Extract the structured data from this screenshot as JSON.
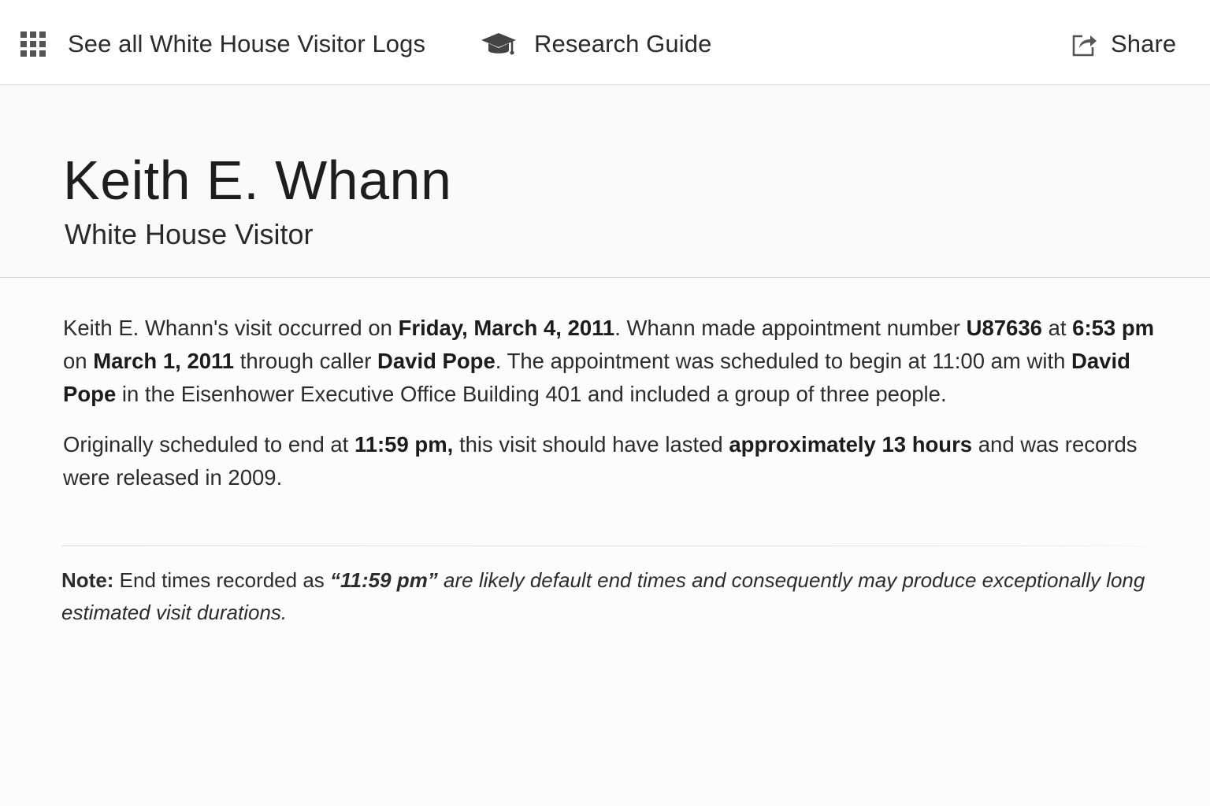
{
  "topbar": {
    "visitor_logs_label": "See all White House Visitor Logs",
    "research_label": "Research Guide",
    "share_label": "Share",
    "icons": {
      "visitor_logs": "grid-icon",
      "research": "graduation-cap-icon",
      "share": "share-icon"
    }
  },
  "hero": {
    "name": "Keith E. Whann",
    "subtitle": "White House Visitor"
  },
  "visit": {
    "p1_intro": "Keith E. Whann's visit occurred on ",
    "visit_date": "Friday, March 4, 2011",
    "p1_made": ". Whann made appointment number ",
    "appointment_number": "U87636",
    "p1_at": " at ",
    "made_time": "6:53 pm",
    "p1_on": " on ",
    "made_date": "March 1, 2011",
    "p1_caller": " through caller ",
    "caller": "David Pope",
    "p1_begin": ". The appointment was scheduled to begin at 11:00 am with ",
    "visitee": "David Pope",
    "p1_location": " in the Eisenhower Executive Office Building 401 and included a group of three people.",
    "p2_intro": "Originally scheduled to end at ",
    "end_time": "11:59 pm,",
    "p2_lasted": " this visit should have lasted ",
    "duration": "approximately 13 hours",
    "p2_outro": " and was records were released in 2009."
  },
  "note": {
    "label": "Note:",
    "text_plain": " End times recorded as ",
    "quoted_time": "“11:59 pm”",
    "text_italic": " are likely default end times and consequently may produce exceptionally long estimated visit durations."
  }
}
